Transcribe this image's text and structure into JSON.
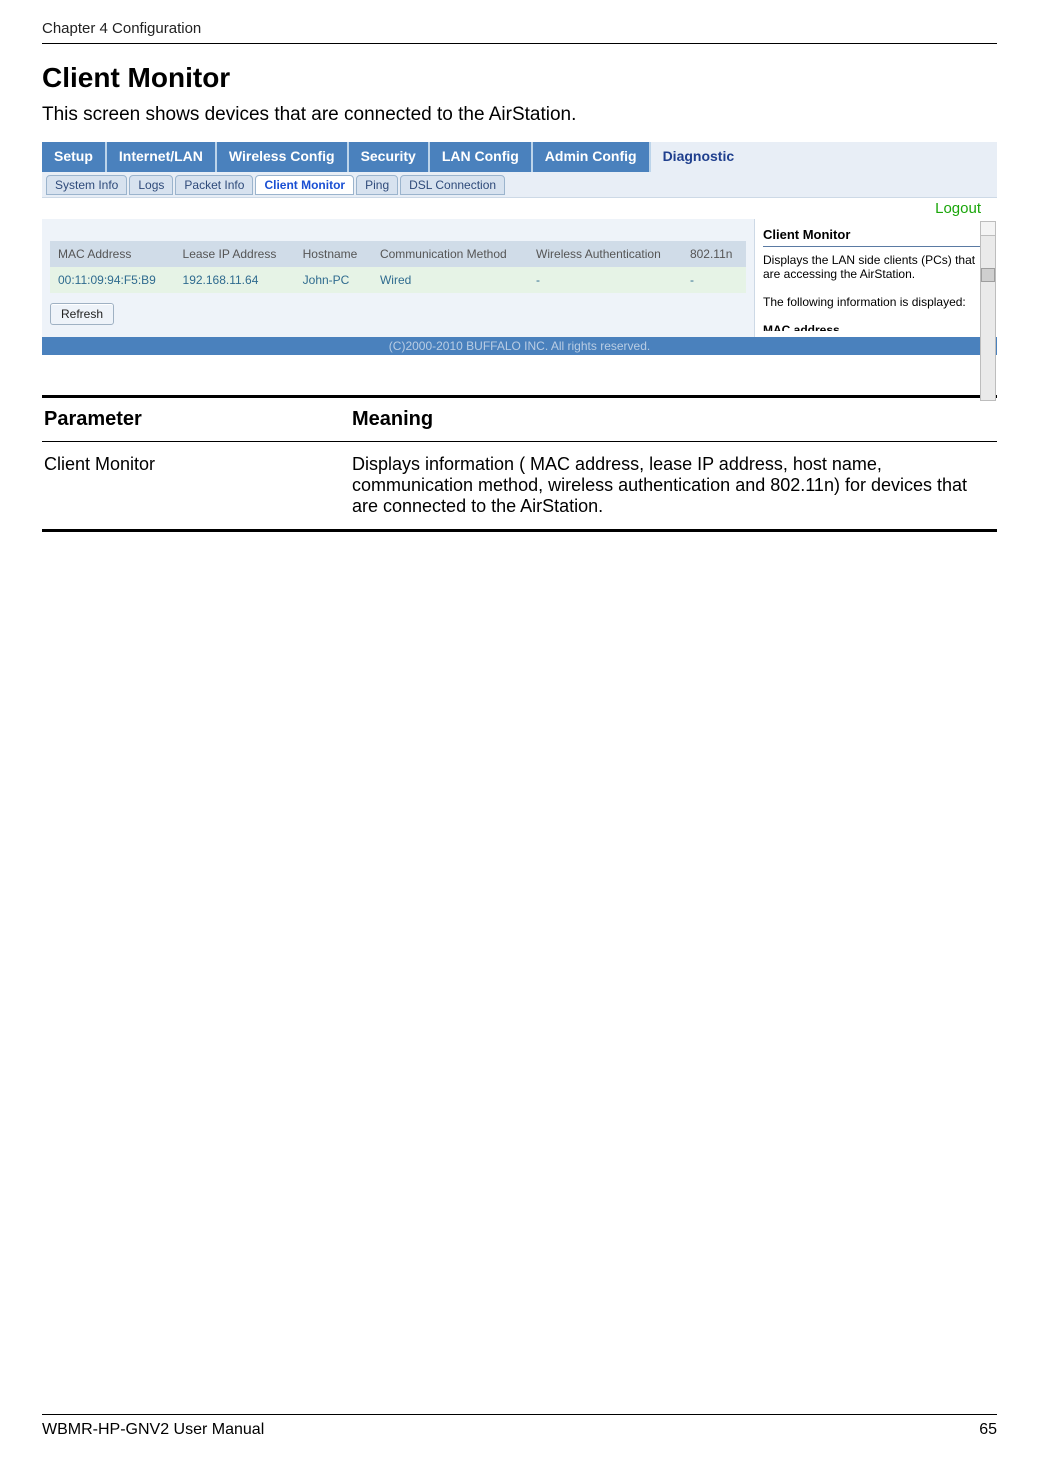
{
  "header": {
    "chapter": "Chapter 4  Configuration"
  },
  "section": {
    "title": "Client Monitor",
    "intro": "This screen shows devices that are connected to the AirStation."
  },
  "ui": {
    "tabs": [
      "Setup",
      "Internet/LAN",
      "Wireless Config",
      "Security",
      "LAN Config",
      "Admin Config",
      "Diagnostic"
    ],
    "subtabs": [
      "System Info",
      "Logs",
      "Packet Info",
      "Client Monitor",
      "Ping",
      "DSL Connection"
    ],
    "active_subtab": "Client Monitor",
    "logout": "Logout",
    "table": {
      "headers": [
        "MAC Address",
        "Lease IP Address",
        "Hostname",
        "Communication Method",
        "Wireless Authentication",
        "802.11n"
      ],
      "row": [
        "00:11:09:94:F5:B9",
        "192.168.11.64",
        "John-PC",
        "Wired",
        "-",
        "-"
      ]
    },
    "refresh": "Refresh",
    "side": {
      "title": "Client Monitor",
      "p1": "Displays the LAN side clients (PCs) that are accessing the AirStation.",
      "p2": "The following information is displayed:",
      "cut": "MAC address"
    },
    "copyright": "(C)2000-2010 BUFFALO INC. All rights reserved."
  },
  "param_table": {
    "col1": "Parameter",
    "col2": "Meaning",
    "row_param": "Client Monitor",
    "row_meaning": "Displays information ( MAC address, lease IP address, host name, communication method, wireless authentication and 802.11n) for devices that are connected to the AirStation."
  },
  "footer": {
    "manual": "WBMR-HP-GNV2 User Manual",
    "page": "65"
  }
}
